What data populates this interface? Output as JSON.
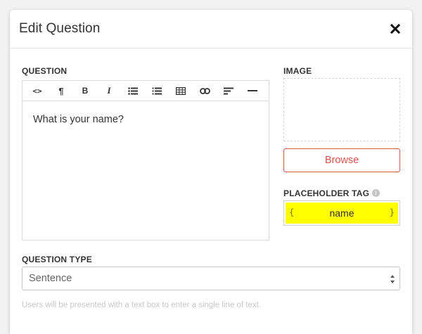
{
  "modal": {
    "title": "Edit Question",
    "close_icon": "close-icon"
  },
  "question": {
    "label": "QUESTION",
    "toolbar": [
      {
        "name": "code-view",
        "icon": "code-icon",
        "glyph": "<>"
      },
      {
        "name": "paragraph",
        "icon": "paragraph-icon",
        "glyph": "¶"
      },
      {
        "name": "bold",
        "icon": "bold-icon",
        "glyph": "B"
      },
      {
        "name": "italic",
        "icon": "italic-icon",
        "glyph": "I"
      },
      {
        "name": "unordered-list",
        "icon": "bullet-list-icon",
        "glyph": ""
      },
      {
        "name": "ordered-list",
        "icon": "numbered-list-icon",
        "glyph": ""
      },
      {
        "name": "table",
        "icon": "table-icon",
        "glyph": ""
      },
      {
        "name": "link",
        "icon": "link-icon",
        "glyph": ""
      },
      {
        "name": "align",
        "icon": "align-left-icon",
        "glyph": ""
      },
      {
        "name": "horizontal-rule",
        "icon": "horizontal-rule-icon",
        "glyph": ""
      }
    ],
    "content": "What is your name?"
  },
  "image": {
    "label": "IMAGE",
    "browse_label": "Browse"
  },
  "placeholder_tag": {
    "label": "PLACEHOLDER TAG",
    "value": "name",
    "open_brace": "{",
    "close_brace": "}",
    "info_glyph": "i"
  },
  "question_type": {
    "label": "QUESTION TYPE",
    "selected": "Sentence",
    "helper": "Users will be presented with a text box to enter a single line of text."
  },
  "colors": {
    "accent_red": "#d9534f",
    "highlight": "#ffff00"
  }
}
